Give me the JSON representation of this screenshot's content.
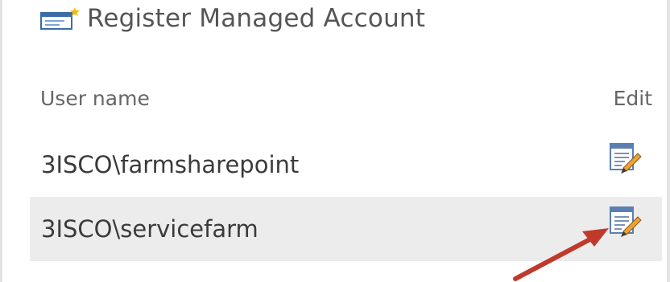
{
  "header": {
    "register_label": "Register Managed Account",
    "register_icon": "account-register-icon"
  },
  "table": {
    "columns": [
      "User name",
      "Edit"
    ],
    "rows": [
      {
        "user_name": "3ISCO\\farmsharepoint",
        "edit_icon": "edit-icon"
      },
      {
        "user_name": "3ISCO\\servicefarm",
        "edit_icon": "edit-icon"
      }
    ]
  },
  "colors": {
    "row_highlight": "#ececec",
    "annotation_arrow": "#c0392b"
  }
}
